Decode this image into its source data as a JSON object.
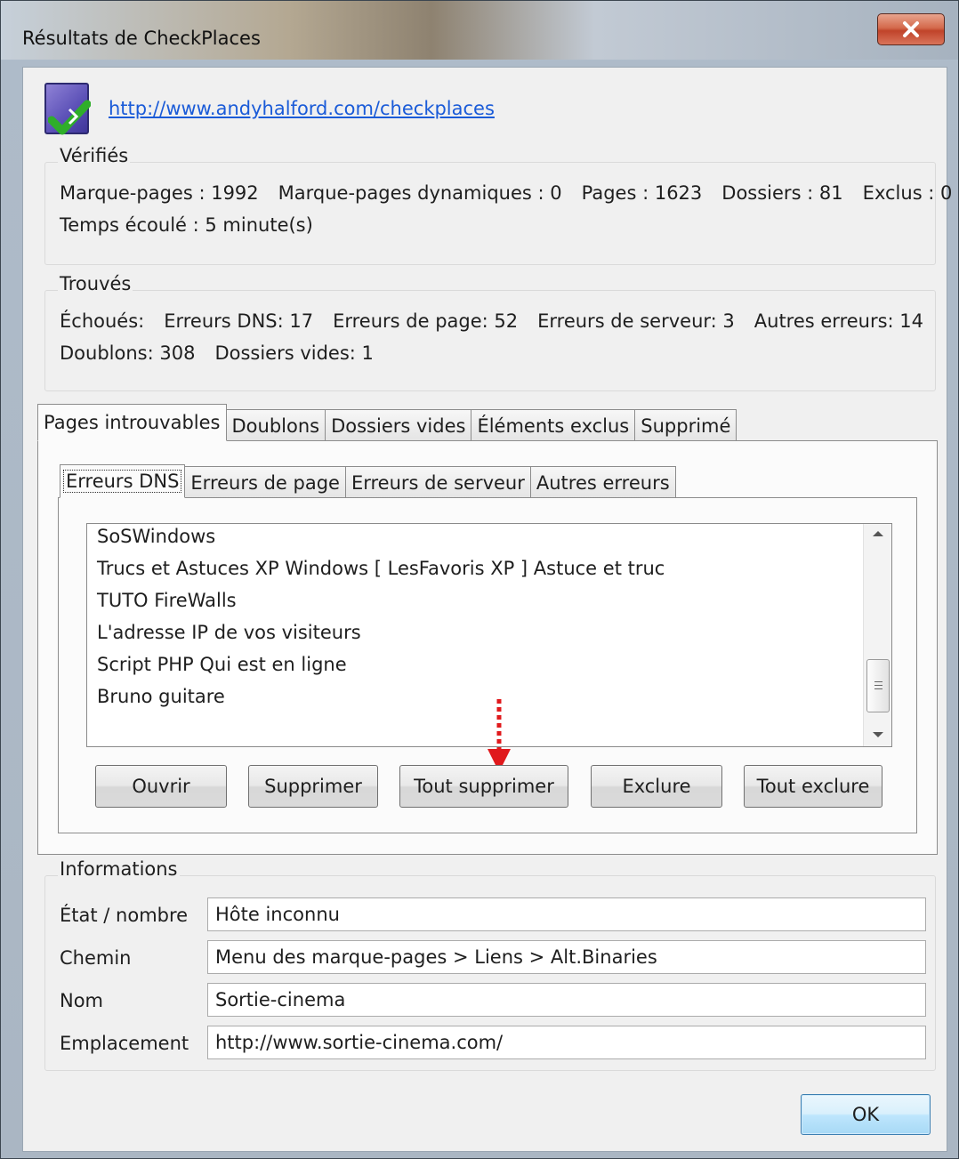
{
  "window": {
    "title": "Résultats de CheckPlaces"
  },
  "header": {
    "url": "http://www.andyhalford.com/checkplaces"
  },
  "verified": {
    "legend": "Vérifiés",
    "bookmarks": "Marque-pages : 1992",
    "dynamic_bookmarks": "Marque-pages dynamiques : 0",
    "pages": "Pages : 1623",
    "folders": "Dossiers : 81",
    "excluded": "Exclus : 0",
    "elapsed": "Temps écoulé : 5 minute(s)"
  },
  "found": {
    "legend": "Trouvés",
    "failed": "Échoués:",
    "dns_errors": "Erreurs DNS: 17",
    "page_errors": "Erreurs de page: 52",
    "server_errors": "Erreurs de serveur: 3",
    "other_errors": "Autres erreurs: 14",
    "duplicates": "Doublons: 308",
    "empty_folders": "Dossiers vides: 1"
  },
  "outer_tabs": [
    "Pages introuvables",
    "Doublons",
    "Dossiers vides",
    "Éléments exclus",
    "Supprimé"
  ],
  "inner_tabs": [
    "Erreurs DNS",
    "Erreurs de page",
    "Erreurs de serveur",
    "Autres erreurs"
  ],
  "list_items": [
    "SoSWindows",
    "Trucs et Astuces XP Windows [ LesFavoris XP ] Astuce et truc",
    "TUTO  FireWalls",
    "L'adresse IP de vos visiteurs",
    "Script PHP Qui est en ligne",
    "Bruno guitare"
  ],
  "buttons": {
    "open": "Ouvrir",
    "delete": "Supprimer",
    "delete_all": "Tout supprimer",
    "exclude": "Exclure",
    "exclude_all": "Tout exclure",
    "ok": "OK"
  },
  "info": {
    "legend": "Informations",
    "state_label": "État / nombre",
    "state_value": "Hôte inconnu",
    "path_label": "Chemin",
    "path_value": "Menu des marque-pages > Liens > Alt.Binaries",
    "name_label": "Nom",
    "name_value": "Sortie-cinema",
    "location_label": "Emplacement",
    "location_value": "http://www.sortie-cinema.com/"
  },
  "colors": {
    "link": "#1a5bd8",
    "annotation_arrow": "#e0191c",
    "ok_button": "#bee6fd"
  },
  "icons": {
    "app": "checkplaces-check-icon",
    "close": "close-icon",
    "annotation": "red-dotted-arrow-icon"
  }
}
